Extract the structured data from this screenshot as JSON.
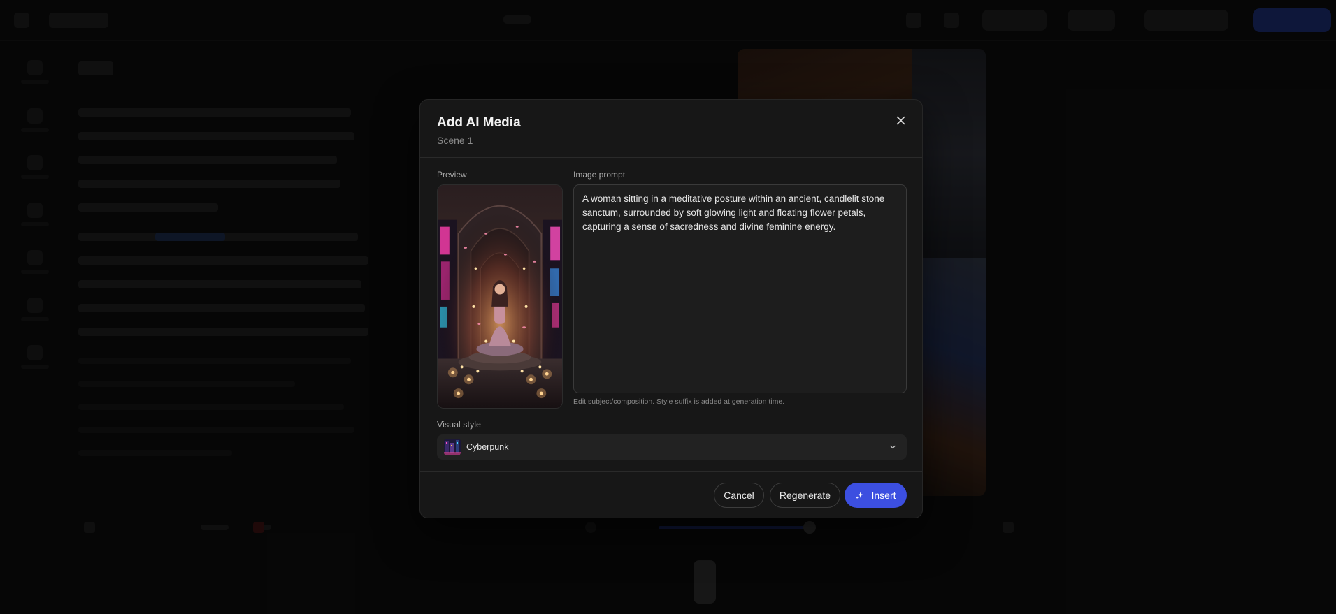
{
  "modal": {
    "title": "Add AI Media",
    "subtitle": "Scene 1",
    "preview_label": "Preview",
    "prompt_label": "Image prompt",
    "prompt_value": "A woman sitting in a meditative posture within an ancient, candlelit stone sanctum, surrounded by soft glowing light and floating flower petals, capturing a sense of sacredness and divine feminine energy.",
    "prompt_hint": "Edit subject/composition. Style suffix is added at generation time.",
    "style_label": "Visual style",
    "style_value": "Cyberpunk",
    "buttons": {
      "cancel": "Cancel",
      "regenerate": "Regenerate",
      "insert": "Insert"
    },
    "icons": {
      "close": "close-icon",
      "chevron": "chevron-down-icon",
      "insert": "sparkles-icon"
    },
    "colors": {
      "accent": "#3c4fe0",
      "surface": "#171717",
      "field": "#1d1d1d"
    }
  }
}
